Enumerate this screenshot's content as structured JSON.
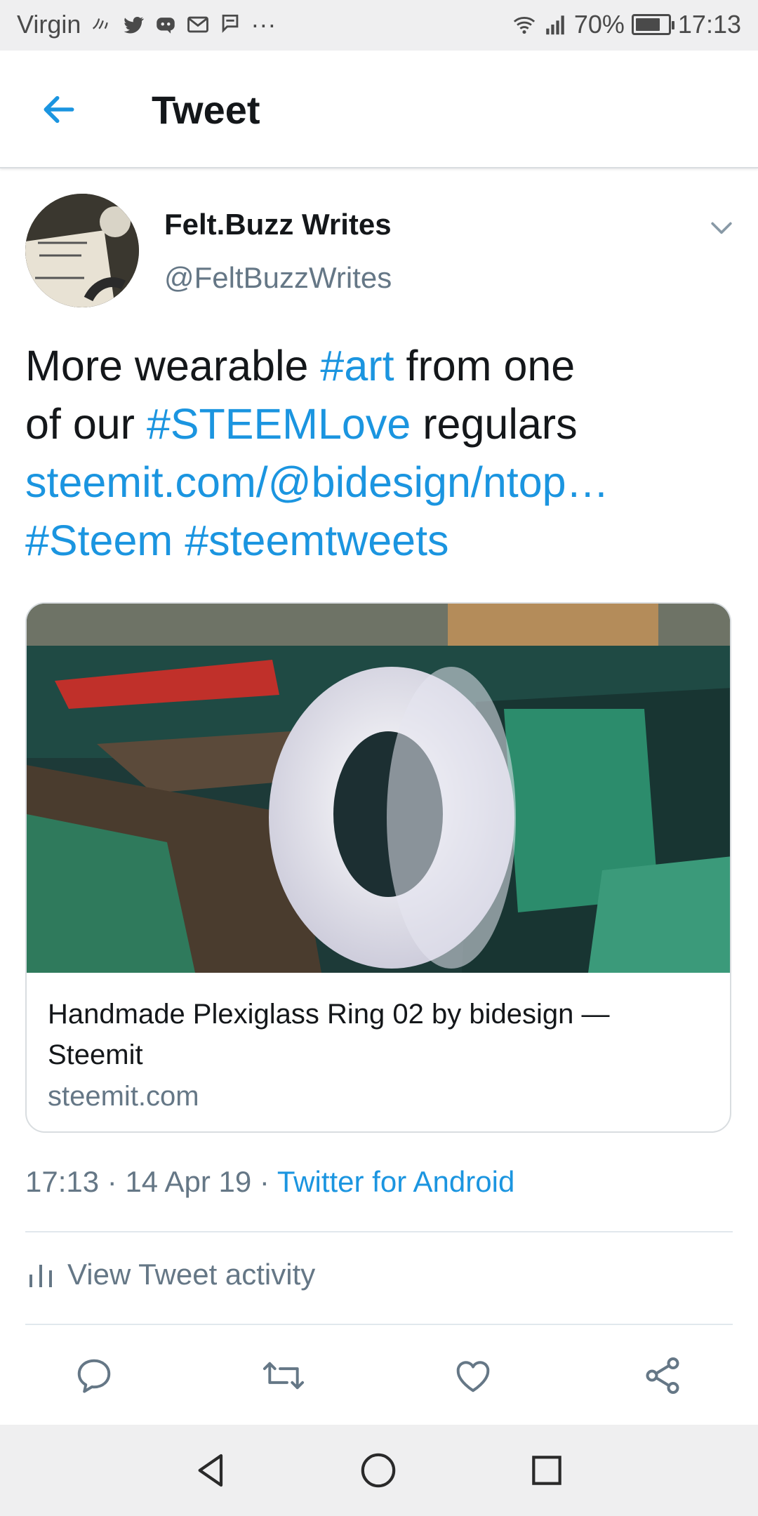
{
  "status_bar": {
    "carrier": "Virgin",
    "notification_icons": [
      "nfc-icon",
      "twitter-icon",
      "discord-icon",
      "gmail-icon",
      "message-icon",
      "more-icon"
    ],
    "overflow": "···",
    "battery_percent": "70%",
    "battery_level": 0.7,
    "time": "17:13"
  },
  "header": {
    "title": "Tweet"
  },
  "tweet": {
    "author_name": "Felt.Buzz Writes",
    "handle": "@FeltBuzzWrites",
    "text_parts": {
      "t1": "More wearable ",
      "l1": "#art",
      "t2": " from one",
      "t3": "of our ",
      "l2": "#STEEMLove",
      "t4": " regulars",
      "l3": "steemit.com/@bidesign/ntop…",
      "l4": "#Steem",
      "t5": " ",
      "l5": "#steemtweets"
    },
    "card": {
      "title": "Handmade Plexiglass Ring 02 by bidesign — Steemit",
      "domain": "steemit.com"
    },
    "meta": {
      "time": "17:13",
      "sep1": " · ",
      "date": "14 Apr 19",
      "sep2": " · ",
      "source": "Twitter for Android"
    },
    "activity_label": "View Tweet activity"
  },
  "colors": {
    "link": "#1b95e0",
    "text": "#14171a",
    "secondary": "#657786",
    "divider": "#e1e8ed",
    "system_bar": "#efeff0"
  },
  "actions": [
    "reply-icon",
    "retweet-icon",
    "like-icon",
    "share-icon"
  ],
  "nav_buttons": [
    "back-triangle-icon",
    "home-circle-icon",
    "recents-square-icon"
  ]
}
